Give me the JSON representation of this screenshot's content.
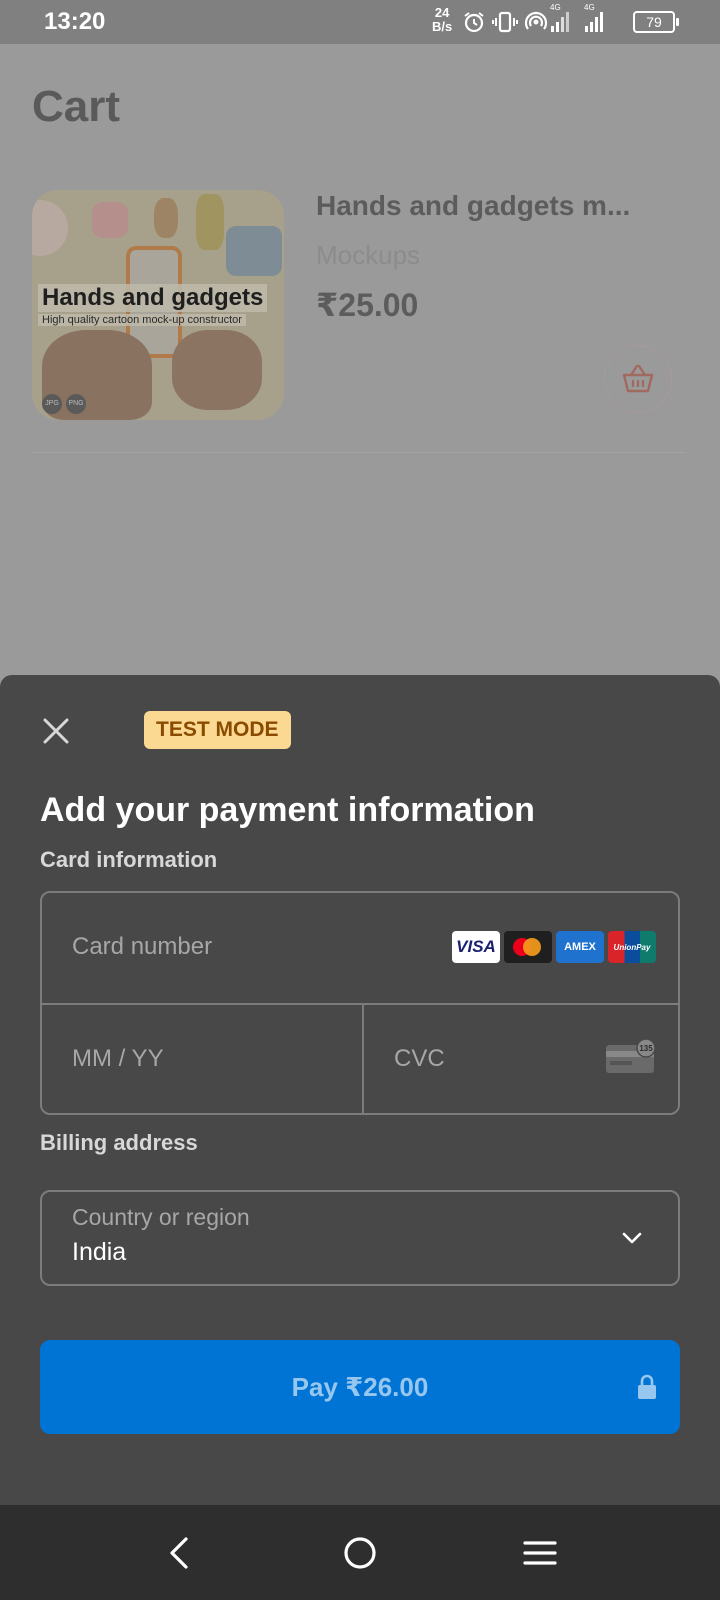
{
  "status_bar": {
    "time": "13:20",
    "net_speed_value": "24",
    "net_speed_unit": "B/s",
    "signal_1_label": "4G",
    "signal_2_label": "4G",
    "battery": "79",
    "icons": [
      "alarm-icon",
      "vibrate-icon",
      "hotspot-icon",
      "signal-icon",
      "signal-icon",
      "battery-icon"
    ]
  },
  "cart": {
    "title": "Cart",
    "item": {
      "name": "Hands and gadgets m...",
      "category": "Mockups",
      "price": "₹25.00",
      "thumbnail": {
        "headline": "Hands and gadgets",
        "subline": "High quality cartoon mock-up constructor",
        "formats": [
          "JPG",
          "PNG"
        ]
      }
    }
  },
  "payment_sheet": {
    "badge": "TEST MODE",
    "title": "Add your payment information",
    "card_section_label": "Card information",
    "card_number_placeholder": "Card number",
    "expiry_placeholder": "MM / YY",
    "cvc_placeholder": "CVC",
    "cvc_icon_text": "135",
    "card_brands": [
      "VISA",
      "Mastercard",
      "AMEX",
      "UnionPay"
    ],
    "billing_label": "Billing address",
    "country_label": "Country or region",
    "country_value": "India",
    "pay_button": "Pay ₹26.00"
  },
  "colors": {
    "pay_button": "#0074d4",
    "badge_bg": "#fbd992",
    "sheet_bg": "#484848"
  }
}
